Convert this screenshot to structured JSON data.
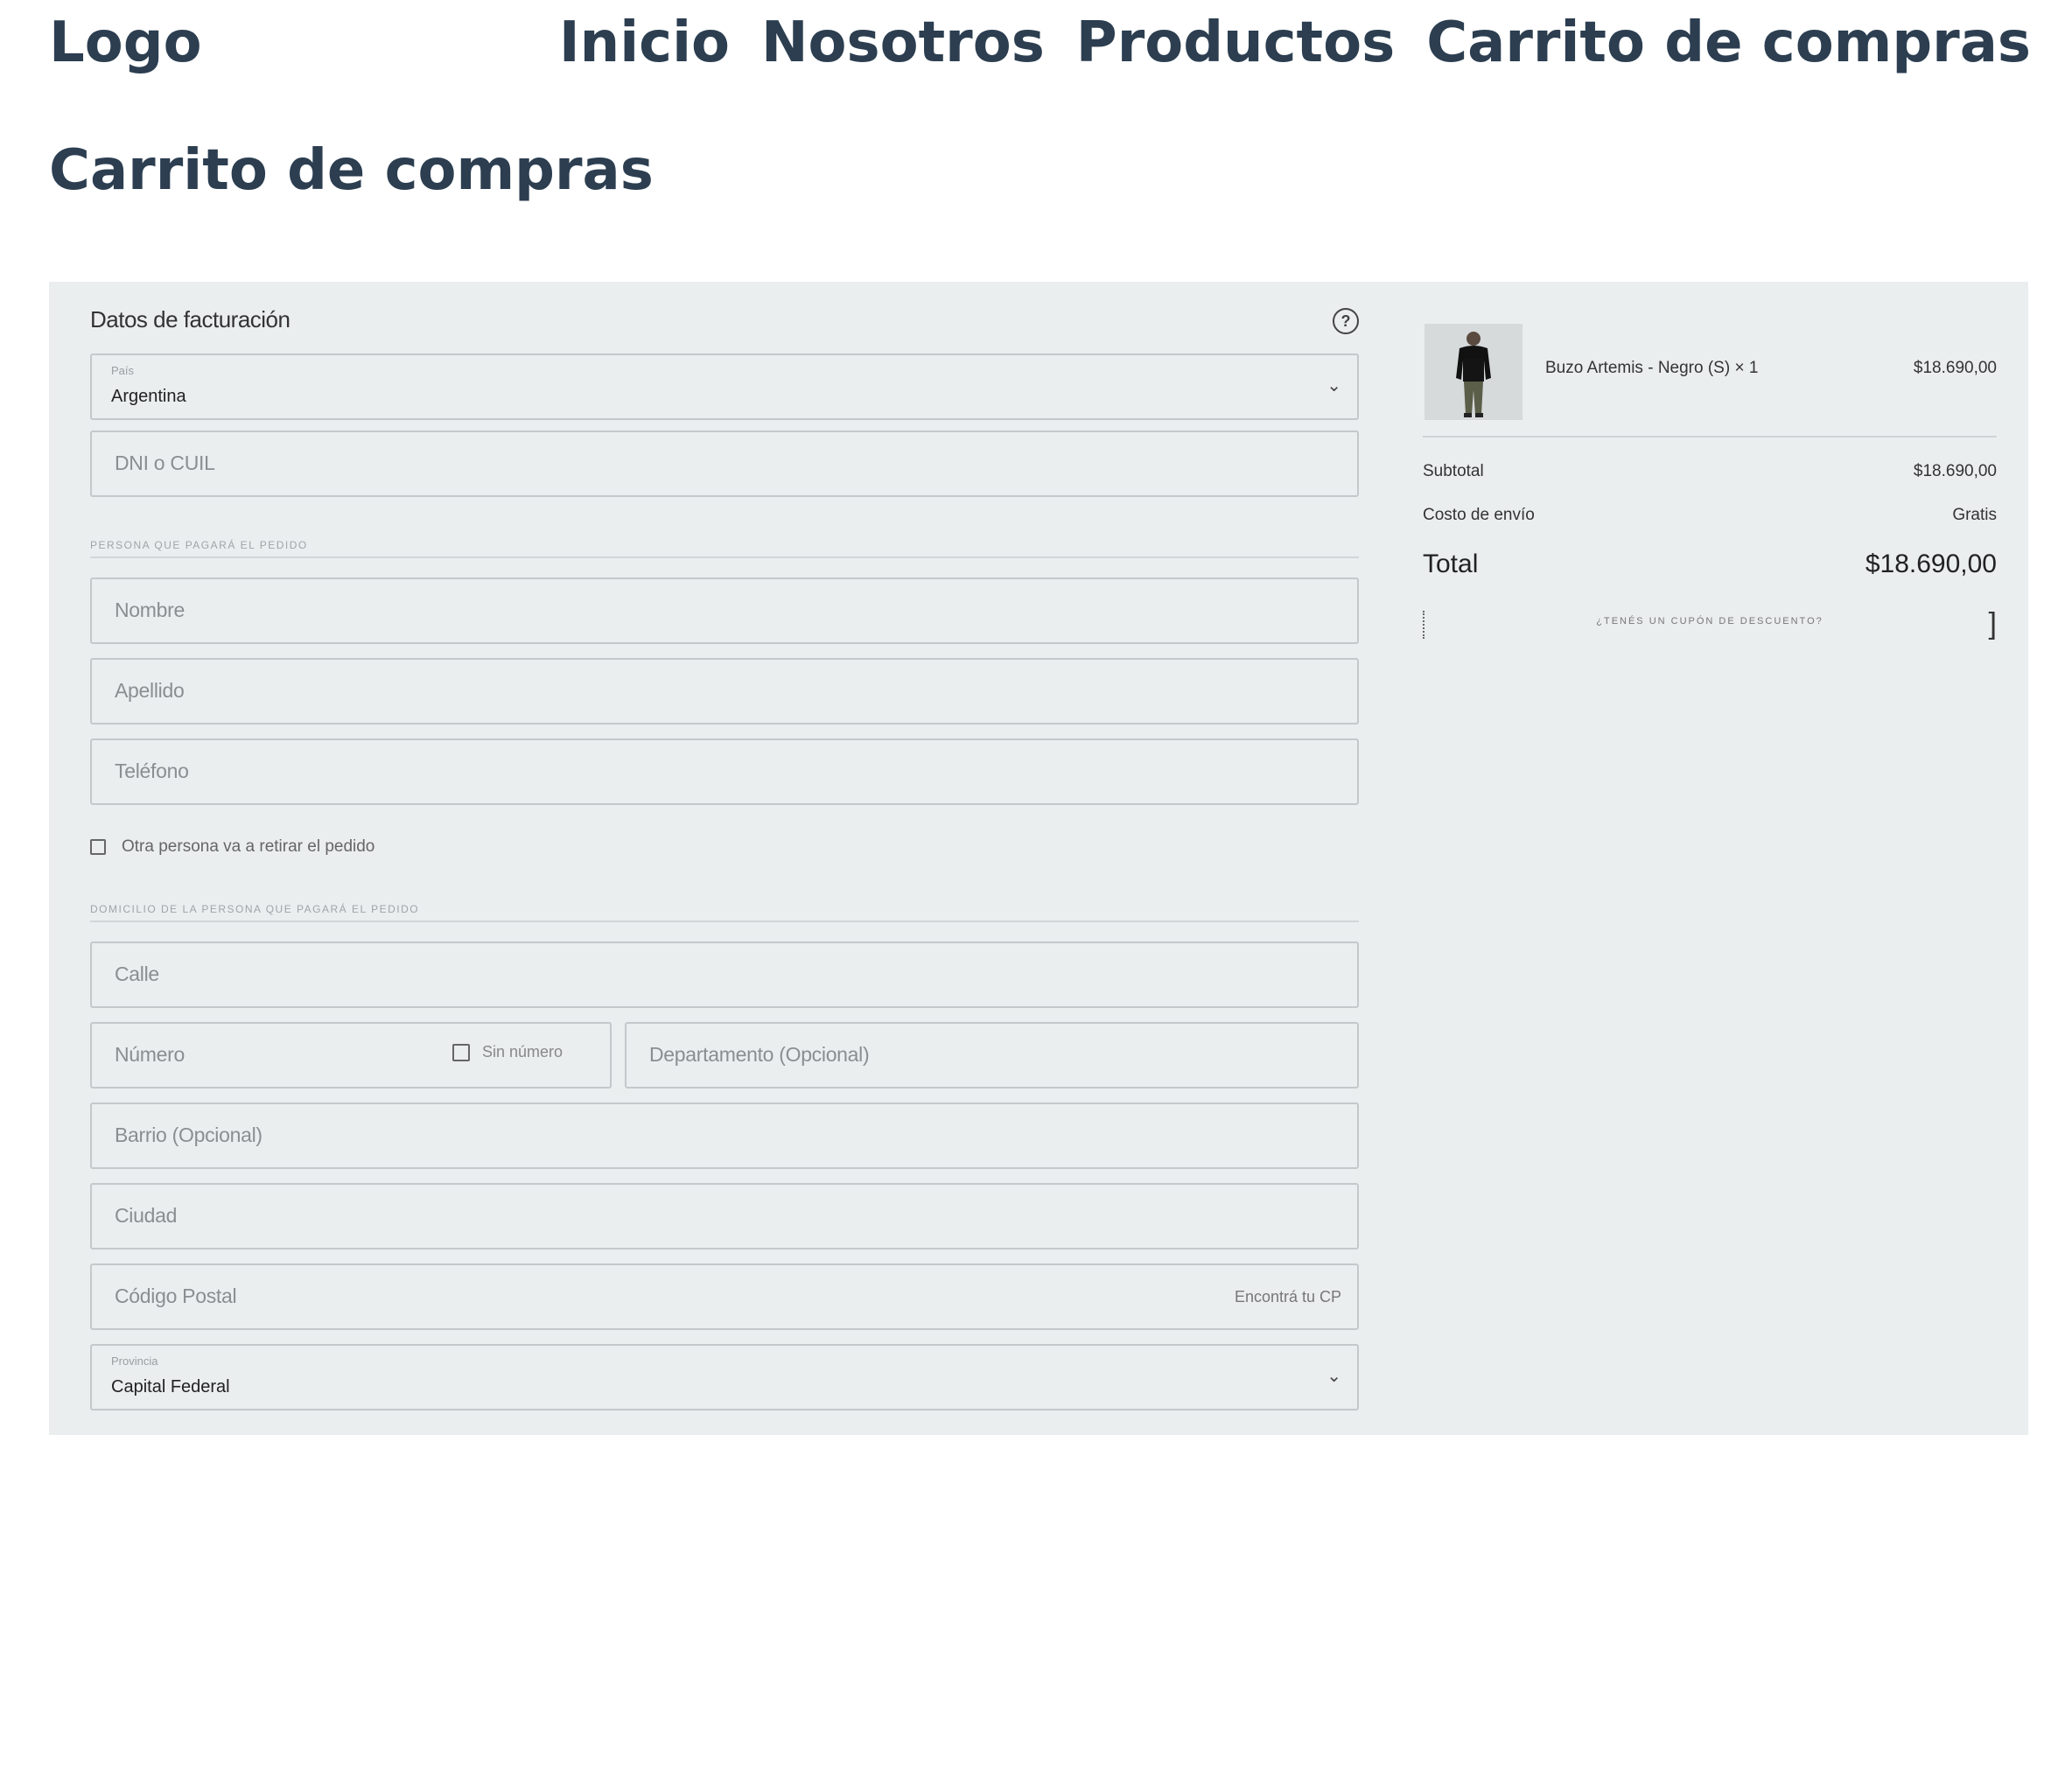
{
  "nav": {
    "logo": "Logo",
    "items": [
      "Inicio",
      "Nosotros",
      "Productos",
      "Carrito de compras"
    ]
  },
  "page_title": "Carrito de compras",
  "checkout": {
    "form_title": "Datos de facturación",
    "country": {
      "label": "País",
      "value": "Argentina"
    },
    "dni_placeholder": "DNI o CUIL",
    "section_payer": "PERSONA QUE PAGARÁ EL PEDIDO",
    "nombre_placeholder": "Nombre",
    "apellido_placeholder": "Apellido",
    "telefono_placeholder": "Teléfono",
    "other_person_label": "Otra persona va a retirar el pedido",
    "section_address": "DOMICILIO DE LA PERSONA QUE PAGARÁ EL PEDIDO",
    "calle_placeholder": "Calle",
    "numero_placeholder": "Número",
    "sin_numero_label": "Sin número",
    "departamento_placeholder": "Departamento (Opcional)",
    "barrio_placeholder": "Barrio (Opcional)",
    "ciudad_placeholder": "Ciudad",
    "cp_placeholder": "Código Postal",
    "cp_link": "Encontrá tu CP",
    "provincia": {
      "label": "Provincia",
      "value": "Capital Federal"
    }
  },
  "summary": {
    "item_name": "Buzo Artemis - Negro (S) × 1",
    "item_price": "$18.690,00",
    "subtotal_label": "Subtotal",
    "subtotal_value": "$18.690,00",
    "shipping_label": "Costo de envío",
    "shipping_value": "Gratis",
    "total_label": "Total",
    "total_value": "$18.690,00",
    "coupon_text": "¿TENÉS UN CUPÓN DE DESCUENTO?"
  },
  "colors": {
    "nav_text": "#2c3e50",
    "panel_bg": "#eaeeef"
  },
  "icons": [
    "help-icon",
    "chevron-down-icon",
    "checkbox-icon",
    "product-thumbnail"
  ]
}
